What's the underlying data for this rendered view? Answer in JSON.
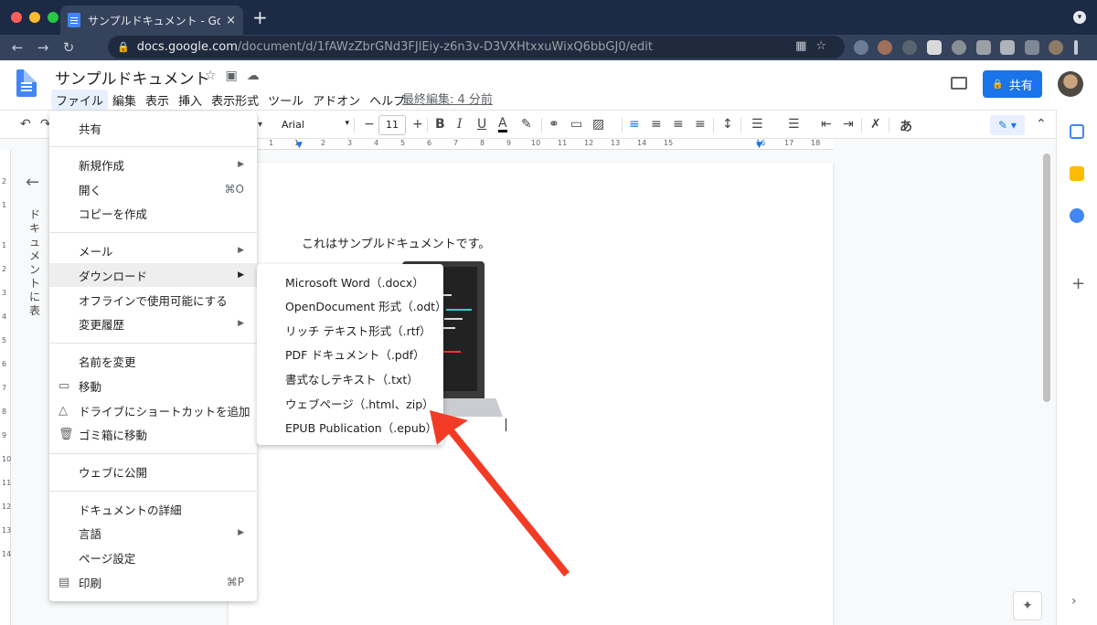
{
  "browser": {
    "tab_title": "サンプルドキュメント - Google Docs",
    "tab_close": "×",
    "new_tab": "+",
    "url_host": "docs.google.com",
    "url_path": "/document/d/1fAWzZbrGNd3FJlEiy-z6n3v-D3VXHtxxuWixQ6bbGJ0/edit"
  },
  "docs": {
    "title": "サンプルドキュメント",
    "menus": [
      "ファイル",
      "編集",
      "表示",
      "挿入",
      "表示形式",
      "ツール",
      "アドオン",
      "ヘルプ"
    ],
    "last_edit": "最終編集: 4 分前",
    "share_label": "共有"
  },
  "format": {
    "font": "Arial",
    "size": "11",
    "input_lang": "あ"
  },
  "ruler": {
    "h_ticks": [
      "1",
      "1",
      "2",
      "3",
      "4",
      "5",
      "6",
      "7",
      "8",
      "9",
      "10",
      "11",
      "12",
      "13",
      "14",
      "15",
      "16",
      "17",
      "18"
    ],
    "v_ticks": [
      "2",
      "1",
      "1",
      "2",
      "3",
      "4",
      "5",
      "6",
      "7",
      "8",
      "9",
      "10",
      "11",
      "12",
      "13",
      "14"
    ]
  },
  "outline": {
    "text": "ドキュメントに表"
  },
  "document": {
    "body_text": "これはサンプルドキュメントです。"
  },
  "file_menu": {
    "items": [
      {
        "label": "共有"
      },
      {
        "label": "新規作成",
        "submenu": true
      },
      {
        "label": "開く",
        "shortcut": "⌘O"
      },
      {
        "label": "コピーを作成"
      },
      {
        "label": "メール",
        "submenu": true
      },
      {
        "label": "ダウンロード",
        "submenu": true
      },
      {
        "label": "オフラインで使用可能にする"
      },
      {
        "label": "変更履歴",
        "submenu": true
      },
      {
        "label": "名前を変更"
      },
      {
        "label": "移動"
      },
      {
        "label": "ドライブにショートカットを追加"
      },
      {
        "label": "ゴミ箱に移動"
      },
      {
        "label": "ウェブに公開"
      },
      {
        "label": "ドキュメントの詳細"
      },
      {
        "label": "言語",
        "submenu": true
      },
      {
        "label": "ページ設定"
      },
      {
        "label": "印刷",
        "shortcut": "⌘P"
      }
    ]
  },
  "download_menu": {
    "items": [
      "Microsoft Word（.docx）",
      "OpenDocument 形式（.odt）",
      "リッチ テキスト形式（.rtf）",
      "PDF ドキュメント（.pdf）",
      "書式なしテキスト（.txt）",
      "ウェブページ（.html、zip）",
      "EPUB Publication（.epub）"
    ]
  },
  "colors": {
    "accent": "#1a73e8",
    "arrow": "#f23b25",
    "chrome_dark": "#1c2a45"
  }
}
